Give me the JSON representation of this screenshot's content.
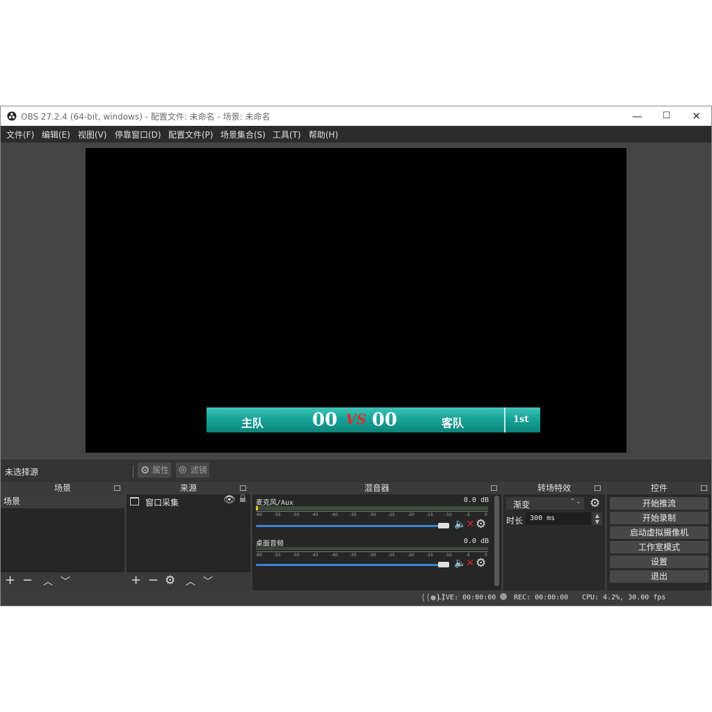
{
  "window": {
    "title": "OBS 27.2.4 (64-bit, windows) - 配置文件: 未命名 - 场景: 未命名",
    "minimize": "—",
    "maximize": "☐",
    "close": "✕"
  },
  "menu": [
    "文件(F)",
    "编辑(E)",
    "视图(V)",
    "停靠窗口(D)",
    "配置文件(P)",
    "场景集合(S)",
    "工具(T)",
    "帮助(H)"
  ],
  "scoreboard": {
    "home": "主队",
    "home_score": "00",
    "vs": "VS",
    "away_score": "00",
    "away": "客队",
    "period": "1st",
    "vs_color": "#d9302a"
  },
  "source_bar": {
    "label": "未选择源",
    "properties": "属性",
    "filters": "滤镜"
  },
  "scenes": {
    "title": "场景",
    "items": [
      "场景"
    ]
  },
  "sources": {
    "title": "来源",
    "items": [
      "窗口采集"
    ]
  },
  "mixer": {
    "title": "混音器",
    "channels": [
      {
        "name": "麦克风/Aux",
        "db": "0.0 dB",
        "muted": true
      },
      {
        "name": "桌面音频",
        "db": "0.0 dB",
        "muted": true
      }
    ],
    "ticks": [
      "-60",
      "-55",
      "-50",
      "-45",
      "-40",
      "-35",
      "-30",
      "-25",
      "-20",
      "-15",
      "-10",
      "-5",
      "0"
    ]
  },
  "transitions": {
    "title": "转场特效",
    "selected": "渐变",
    "duration_label": "时长",
    "duration_value": "300 ms"
  },
  "controls": {
    "title": "控件",
    "buttons": [
      "开始推流",
      "开始录制",
      "启动虚拟摄像机",
      "工作室模式",
      "设置",
      "退出"
    ]
  },
  "status": {
    "live": "LIVE: 00:00:00",
    "rec": "REC: 00:00:00",
    "cpu": "CPU: 4.2%, 30.00 fps"
  },
  "colors": {
    "accent_blue": "#3a86d6",
    "mute_red": "#e02424",
    "scoreboard_teal": "#17a398"
  }
}
